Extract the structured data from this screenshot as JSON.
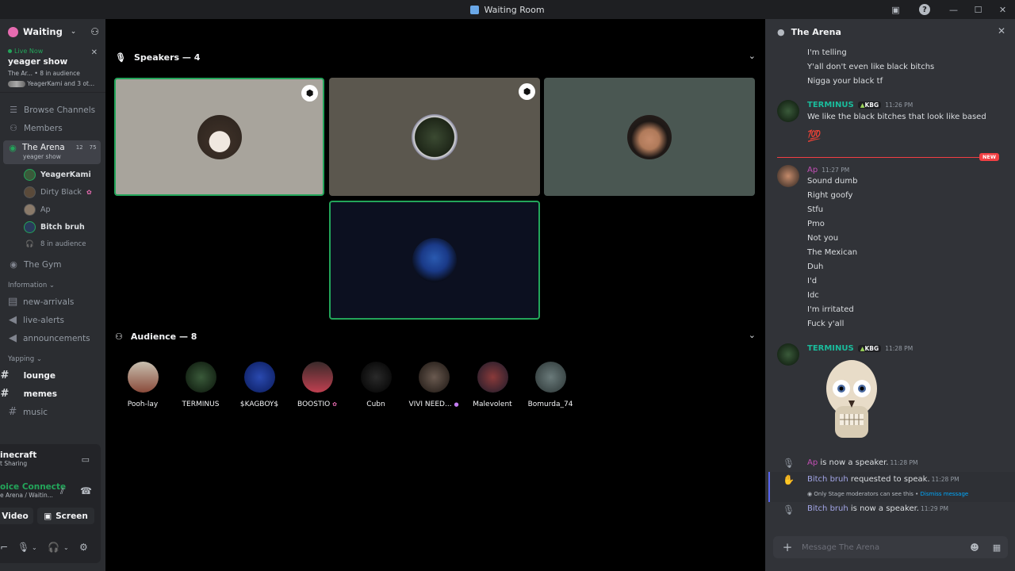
{
  "window": {
    "title": "Waiting Room"
  },
  "sidebar": {
    "server_name": "Waiting R...",
    "live": {
      "tag": "Live Now",
      "title": "yeager show",
      "meta": "The Ar... • 8 in audience",
      "attendees": "YeagerKami and 3 ot..."
    },
    "nav": [
      {
        "label": "Browse Channels",
        "icon": "browse-channels-icon"
      },
      {
        "label": "Members",
        "icon": "members-icon"
      }
    ],
    "active_stage": {
      "name": "The Arena",
      "count_a": "12",
      "count_b": "75",
      "topic": "yeager show"
    },
    "speakers": [
      "YeagerKami",
      "Dirty Black",
      "Ap",
      "Bitch bruh"
    ],
    "audience_count": "8 in audience",
    "other_stage": "The Gym",
    "categories": [
      {
        "label": "Information",
        "channels": [
          "new-arrivals",
          "live-alerts",
          "announcements"
        ]
      },
      {
        "label": "Yapping",
        "channels": [
          "lounge",
          "memes",
          "music"
        ]
      }
    ],
    "panel": {
      "activity_title": "inecraft",
      "activity_sub": "t Sharing",
      "voice_status": "oice Connecte",
      "voice_sub": "e Arena / Waitin...",
      "video_label": "Video",
      "screen_label": "Screen"
    }
  },
  "main": {
    "speakers_header": "Speakers — 4",
    "audience_header": "Audience — 8",
    "audience": [
      "Pooh-lay",
      "TERMINUS",
      "$KAGBOY$",
      "BOOSTIO",
      "Cubn",
      "VIVI NEED...",
      "Malevolent",
      "Bomurda_74"
    ]
  },
  "chat": {
    "title": "The Arena",
    "prev_lines": [
      "I'm telling",
      "Y'all don't even like black bitchs",
      "Nigga your black tf"
    ],
    "msg1": {
      "user": "TERMINUS",
      "tag": "KBG",
      "time": "11:26 PM",
      "text": "We like the black bitches that look like based",
      "emoji": "💯"
    },
    "new_label": "NEW",
    "msg2": {
      "user": "Ap",
      "time": "11:27 PM",
      "lines": [
        "Sound dumb",
        "Right goofy",
        "Stfu",
        "Pmo",
        "Not you",
        "The Mexican",
        "Duh",
        "I'd",
        "Idc",
        "I'm irritated",
        "Fuck y'all"
      ]
    },
    "msg3": {
      "user": "TERMINUS",
      "tag": "KBG",
      "time": "11:28 PM"
    },
    "sys1": {
      "user": "Ap",
      "text": "is now a speaker.",
      "time": "11:28 PM"
    },
    "sys2": {
      "user": "Bitch bruh",
      "text": "requested to speak.",
      "time": "11:28 PM",
      "note": "Only Stage moderators can see this •",
      "dismiss": "Dismiss message"
    },
    "sys3": {
      "user": "Bitch bruh",
      "text": "is now a speaker.",
      "time": "11:29 PM"
    },
    "composer_placeholder": "Message The Arena"
  }
}
